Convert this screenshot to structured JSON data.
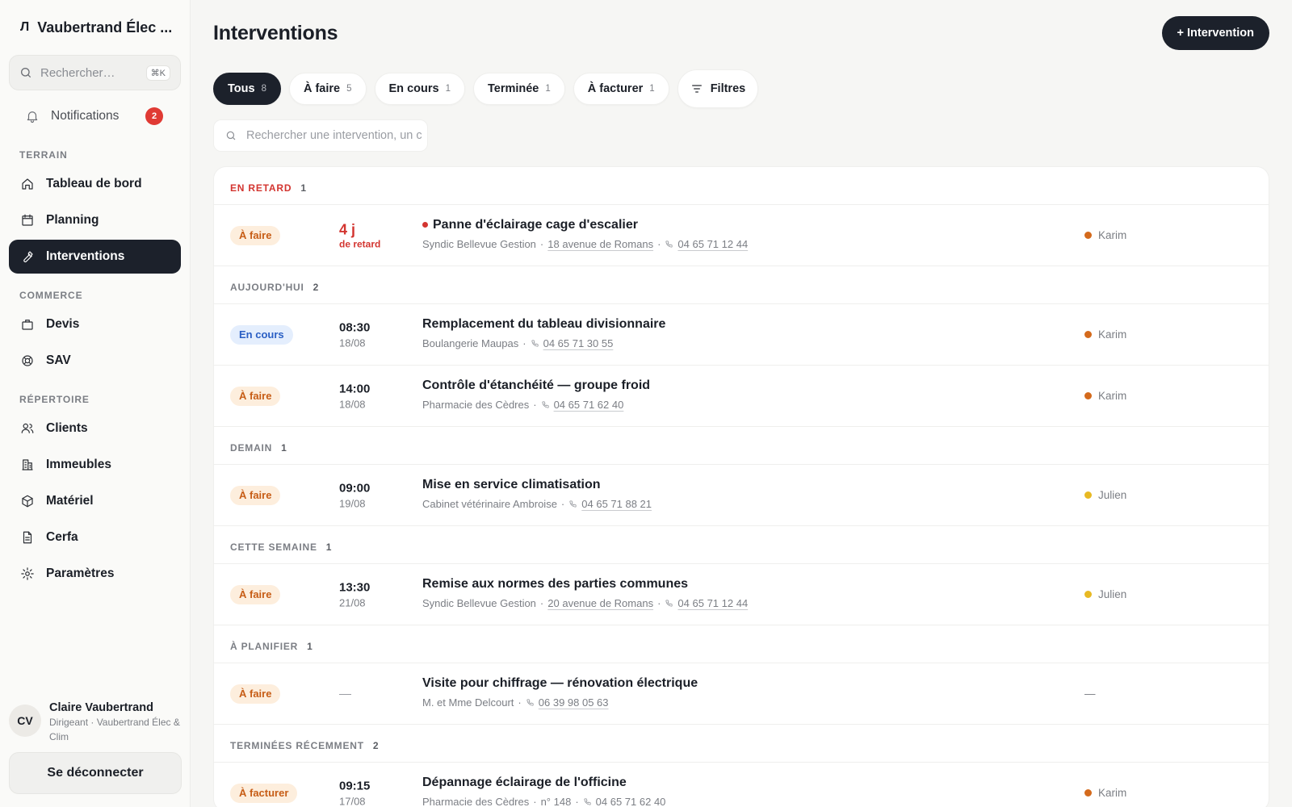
{
  "app": {
    "logo": "♫",
    "name": "Vaubertrand Élec ..."
  },
  "sidebar": {
    "search_placeholder": "Rechercher…",
    "search_shortcut": "⌘K",
    "notifications": {
      "label": "Notifications",
      "count": "2"
    },
    "sections": {
      "terrain": "TERRAIN",
      "commerce": "COMMERCE",
      "repertoire": "RÉPERTOIRE"
    },
    "items": {
      "dashboard": "Tableau de bord",
      "planning": "Planning",
      "interventions": "Interventions",
      "devis": "Devis",
      "sav": "SAV",
      "clients": "Clients",
      "immeubles": "Immeubles",
      "materiel": "Matériel",
      "cerfa": "Cerfa",
      "parametres": "Paramètres"
    },
    "user": {
      "initials": "CV",
      "name": "Claire Vaubertrand",
      "role": "Dirigeant · Vaubertrand Élec & Clim"
    },
    "logout": "Se déconnecter"
  },
  "header": {
    "title": "Interventions",
    "new_button": "+ Intervention"
  },
  "tabs": [
    {
      "label": "Tous",
      "count": "8"
    },
    {
      "label": "À faire",
      "count": "5"
    },
    {
      "label": "En cours",
      "count": "1"
    },
    {
      "label": "Terminée",
      "count": "1"
    },
    {
      "label": "À facturer",
      "count": "1"
    }
  ],
  "filters_label": "Filtres",
  "list_search_placeholder": "Rechercher une intervention, un c",
  "groups": [
    {
      "label": "EN RETARD",
      "count": "1"
    },
    {
      "label": "AUJOURD'HUI",
      "count": "2"
    },
    {
      "label": "DEMAIN",
      "count": "1"
    },
    {
      "label": "CETTE SEMAINE",
      "count": "1"
    },
    {
      "label": "À PLANIFIER",
      "count": "1"
    },
    {
      "label": "TERMINÉES RÉCEMMENT",
      "count": "2"
    }
  ],
  "rows": [
    {
      "status": "À faire",
      "time": "4 j",
      "date": "de retard",
      "title": "Panne d'éclairage cage d'escalier",
      "client": "Syndic Bellevue Gestion",
      "address": "18 avenue de Romans",
      "phone": "04 65 71 12 44",
      "tech": "Karim",
      "tech_color": "#d46a1c"
    },
    {
      "status": "En cours",
      "time": "08:30",
      "date": "18/08",
      "title": "Remplacement du tableau divisionnaire",
      "client": "Boulangerie Maupas",
      "phone": "04 65 71 30 55",
      "tech": "Karim",
      "tech_color": "#d46a1c"
    },
    {
      "status": "À faire",
      "time": "14:00",
      "date": "18/08",
      "title": "Contrôle d'étanchéité — groupe froid",
      "client": "Pharmacie des Cèdres",
      "phone": "04 65 71 62 40",
      "tech": "Karim",
      "tech_color": "#d46a1c"
    },
    {
      "status": "À faire",
      "time": "09:00",
      "date": "19/08",
      "title": "Mise en service climatisation",
      "client": "Cabinet vétérinaire Ambroise",
      "phone": "04 65 71 88 21",
      "tech": "Julien",
      "tech_color": "#e8b923"
    },
    {
      "status": "À faire",
      "time": "13:30",
      "date": "21/08",
      "title": "Remise aux normes des parties communes",
      "client": "Syndic Bellevue Gestion",
      "address": "20 avenue de Romans",
      "phone": "04 65 71 12 44",
      "tech": "Julien",
      "tech_color": "#e8b923"
    },
    {
      "status": "À faire",
      "time": "—",
      "title": "Visite pour chiffrage — rénovation électrique",
      "client": "M. et Mme Delcourt",
      "phone": "06 39 98 05 63",
      "tech": "—"
    },
    {
      "status": "À facturer",
      "time": "09:15",
      "date": "17/08",
      "title": "Dépannage éclairage de l'officine",
      "client": "Pharmacie des Cèdres",
      "address": "n° 148",
      "phone": "04 65 71 62 40",
      "tech": "Karim",
      "tech_color": "#d46a1c"
    }
  ]
}
